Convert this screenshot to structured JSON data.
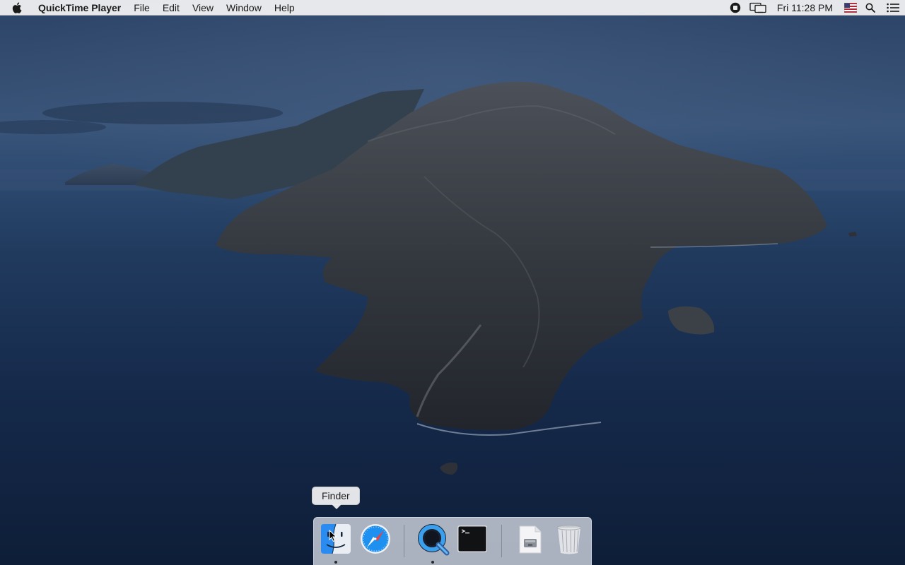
{
  "menubar": {
    "apple_icon": "apple-icon",
    "app_name": "QuickTime Player",
    "menus": [
      "File",
      "Edit",
      "View",
      "Window",
      "Help"
    ],
    "status_icons": [
      "screen-recording-stop-icon",
      "display-mirroring-icon",
      "us-flag-input-icon",
      "spotlight-search-icon",
      "notification-center-icon"
    ],
    "clock": "Fri 11:28 PM"
  },
  "dock": {
    "items": [
      {
        "name": "Finder",
        "icon": "finder-icon",
        "running": true
      },
      {
        "name": "Safari",
        "icon": "safari-icon",
        "running": false
      },
      {
        "name": "QuickTime Player",
        "icon": "quicktime-icon",
        "running": true
      },
      {
        "name": "Terminal",
        "icon": "terminal-icon",
        "running": false
      },
      {
        "name": "Downloads",
        "icon": "downloads-stack-icon",
        "running": false
      },
      {
        "name": "Trash",
        "icon": "trash-icon",
        "running": false
      }
    ],
    "tooltip": "Finder"
  },
  "wallpaper": {
    "description_icon": "catalina-island-wallpaper",
    "colors": {
      "sky": "#2c4366",
      "sea": "#15294a",
      "rock": "#3a3f47"
    }
  }
}
